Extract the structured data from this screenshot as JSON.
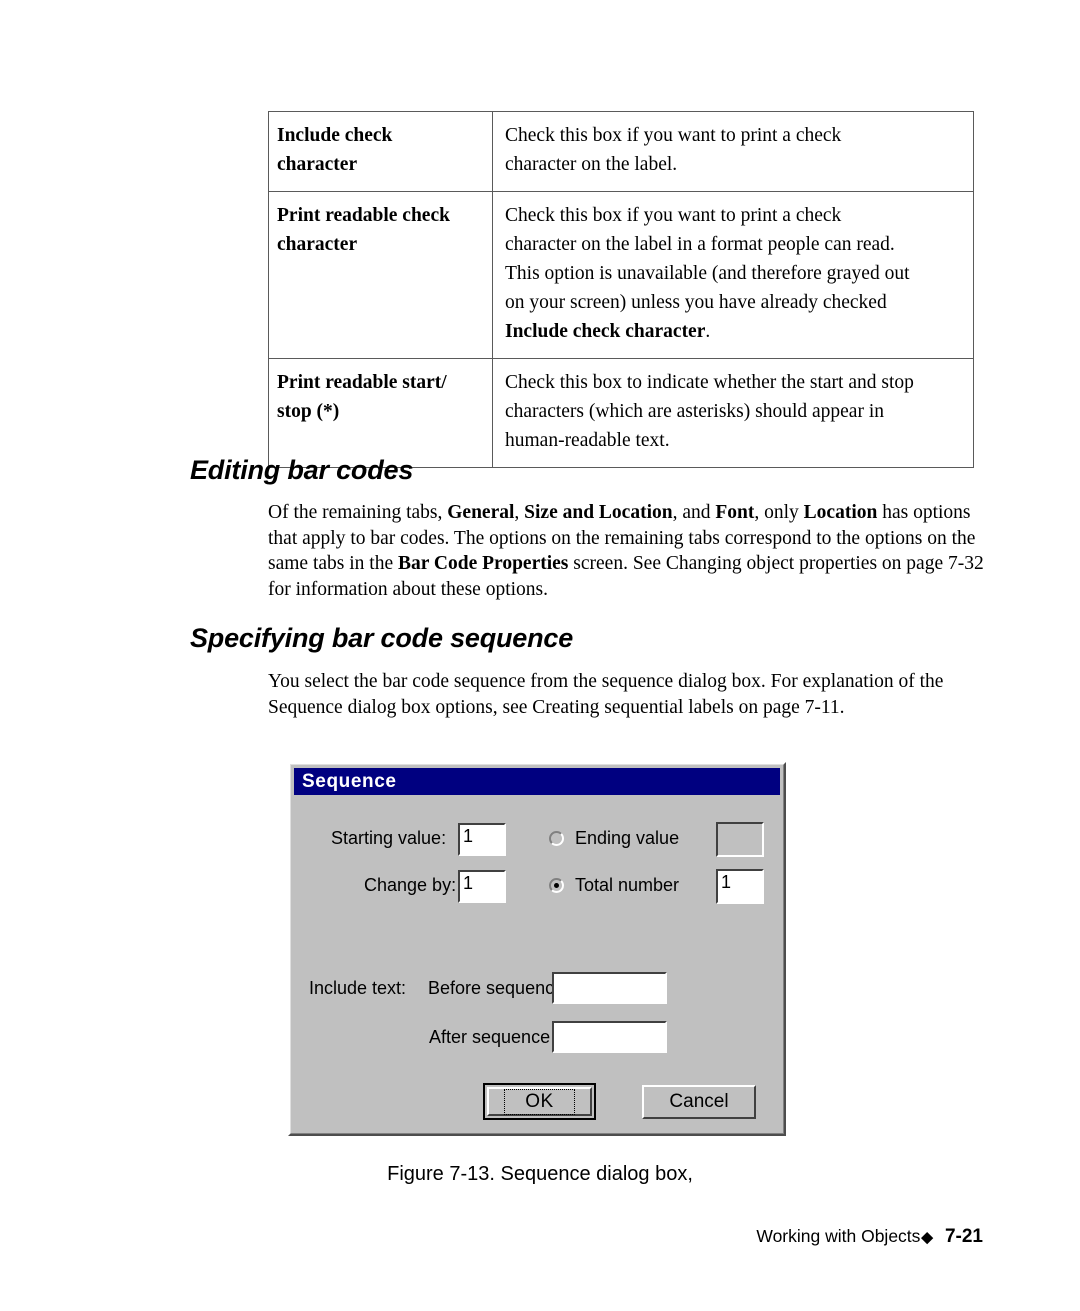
{
  "table": {
    "rows": [
      {
        "term_lines": [
          "Include check",
          "character"
        ],
        "description": [
          {
            "text": "Check this box if you want to print a check",
            "bold": false
          },
          {
            "text": "character on the label.",
            "bold": false
          }
        ]
      },
      {
        "term_lines": [
          "Print readable check",
          "character"
        ],
        "description": [
          {
            "text": "Check this box if you want to print a check",
            "bold": false
          },
          {
            "text": "character on the label in a format people can read.",
            "bold": false
          },
          {
            "text": "This option is unavailable (and therefore grayed out",
            "bold": false
          },
          {
            "text": "on your screen) unless you have already checked",
            "bold": false
          },
          {
            "text": "Include check character",
            "bold": true,
            "suffix": "."
          }
        ]
      },
      {
        "term_lines": [
          "Print readable start/",
          "stop (*)"
        ],
        "description": [
          {
            "text": "Check this box to indicate whether the start and stop",
            "bold": false
          },
          {
            "text": "characters (which are asterisks) should appear in",
            "bold": false
          },
          {
            "text": "human-readable text.",
            "bold": false
          }
        ]
      }
    ]
  },
  "sections": {
    "editing": {
      "heading": "Editing bar codes",
      "paragraph_html": "Of the remaining tabs, <b>General</b>, <b>Size and Location</b>, and <b>Font</b>, only <b>Location</b> has options that apply to bar codes. The options on the remaining tabs correspond to the options on the same tabs in the <b>Bar Code Properties</b> screen. See Changing object properties on page 7-32 for information about these options."
    },
    "specifying": {
      "heading": "Specifying bar code sequence",
      "paragraph_html": "You select the bar code sequence from the sequence dialog box. For explanation of the Sequence dialog box options, see Creating sequential labels on page 7-11."
    }
  },
  "dialog": {
    "title": "Sequence",
    "fields": {
      "starting_value_label": "Starting value:",
      "starting_value": "1",
      "change_by_label": "Change by:",
      "change_by": "1",
      "ending_value_label": "Ending value",
      "ending_value": "",
      "ending_value_selected": false,
      "total_number_label": "Total number",
      "total_number": "1",
      "total_number_selected": true,
      "include_text_label": "Include text:",
      "before_sequence_label": "Before sequence",
      "before_sequence": "",
      "after_sequence_label": "After sequence",
      "after_sequence": ""
    },
    "buttons": {
      "ok": "OK",
      "cancel": "Cancel"
    },
    "colors": {
      "titlebar": "#000080",
      "face": "#c0c0c0",
      "field": "#ffffff"
    }
  },
  "figure": {
    "caption": "Figure 7-13. Sequence dialog box,"
  },
  "footer": {
    "label": "Working with Objects",
    "diamond": "◆",
    "page": "7-21"
  }
}
